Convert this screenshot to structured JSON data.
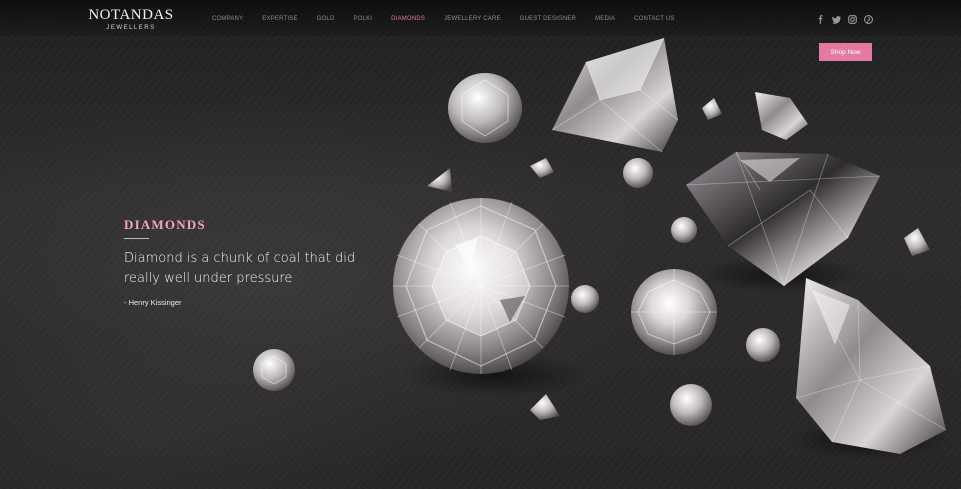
{
  "brand": {
    "name": "NOTANDAS",
    "tagline": "JEWELLERS"
  },
  "nav": {
    "items": [
      {
        "label": "COMPANY",
        "active": false
      },
      {
        "label": "EXPERTISE",
        "active": false
      },
      {
        "label": "GOLD",
        "active": false
      },
      {
        "label": "POLKI",
        "active": false
      },
      {
        "label": "DIAMONDS",
        "active": true
      },
      {
        "label": "JEWELLERY CARE",
        "active": false
      },
      {
        "label": "GUEST DESIGNER",
        "active": false
      },
      {
        "label": "MEDIA",
        "active": false
      },
      {
        "label": "CONTACT US",
        "active": false
      }
    ]
  },
  "social": [
    "facebook-icon",
    "twitter-icon",
    "instagram-icon",
    "pinterest-icon"
  ],
  "cta": {
    "label": "Shop Now"
  },
  "hero": {
    "title": "DIAMONDS",
    "quote": "Diamond is a chunk of coal that did really well under pressure",
    "author": "- Henry Kissinger"
  },
  "colors": {
    "accent": "#e27aa3",
    "title": "#eea6c1",
    "background": "#2a2829"
  }
}
